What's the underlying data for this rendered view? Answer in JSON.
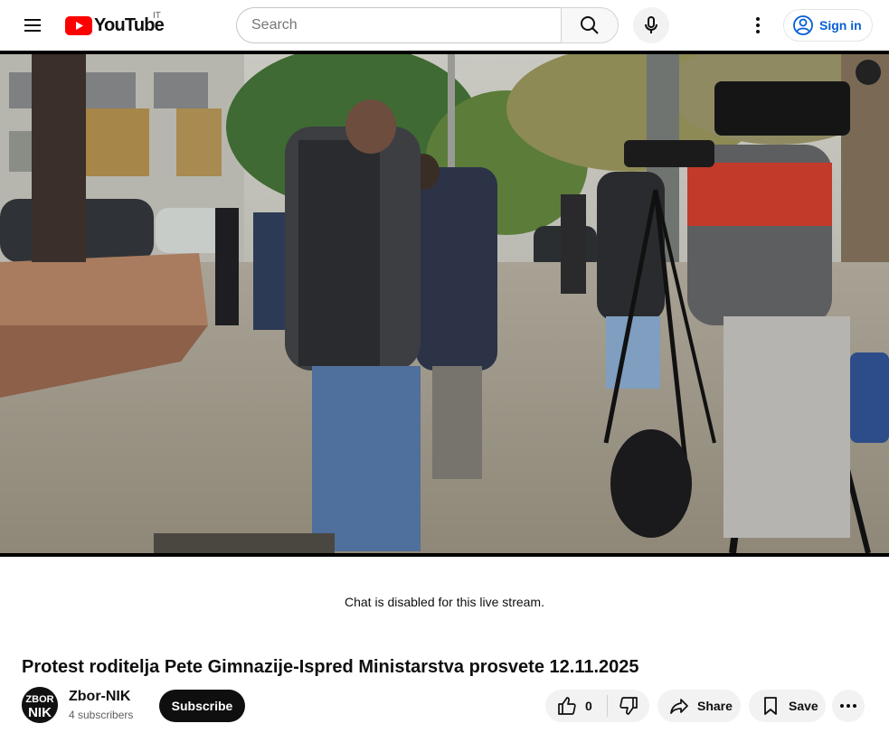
{
  "header": {
    "logo_text": "YouTube",
    "country_code": "IT",
    "search_placeholder": "Search",
    "sign_in_label": "Sign in"
  },
  "player": {
    "chat_notice": "Chat is disabled for this live stream."
  },
  "video": {
    "title": "Protest roditelja Pete Gimnazije-Ispred Ministarstva prosvete 12.11.2025",
    "channel_name": "Zbor-NIK",
    "subscribers": "4 subscribers",
    "avatar_text_top": "ZBOR",
    "avatar_text_bottom": "NIK",
    "subscribe_label": "Subscribe",
    "like_count": "0",
    "share_label": "Share",
    "save_label": "Save"
  },
  "colors": {
    "brand_red": "#ff0000",
    "link_blue": "#065fd4",
    "pill_bg": "#f2f2f2"
  }
}
